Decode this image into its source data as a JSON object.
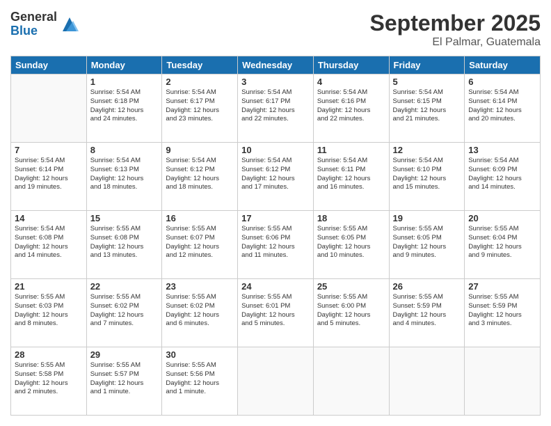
{
  "logo": {
    "general": "General",
    "blue": "Blue"
  },
  "header": {
    "title": "September 2025",
    "location": "El Palmar, Guatemala"
  },
  "weekdays": [
    "Sunday",
    "Monday",
    "Tuesday",
    "Wednesday",
    "Thursday",
    "Friday",
    "Saturday"
  ],
  "weeks": [
    [
      {
        "day": "",
        "info": ""
      },
      {
        "day": "1",
        "info": "Sunrise: 5:54 AM\nSunset: 6:18 PM\nDaylight: 12 hours\nand 24 minutes."
      },
      {
        "day": "2",
        "info": "Sunrise: 5:54 AM\nSunset: 6:17 PM\nDaylight: 12 hours\nand 23 minutes."
      },
      {
        "day": "3",
        "info": "Sunrise: 5:54 AM\nSunset: 6:17 PM\nDaylight: 12 hours\nand 22 minutes."
      },
      {
        "day": "4",
        "info": "Sunrise: 5:54 AM\nSunset: 6:16 PM\nDaylight: 12 hours\nand 22 minutes."
      },
      {
        "day": "5",
        "info": "Sunrise: 5:54 AM\nSunset: 6:15 PM\nDaylight: 12 hours\nand 21 minutes."
      },
      {
        "day": "6",
        "info": "Sunrise: 5:54 AM\nSunset: 6:14 PM\nDaylight: 12 hours\nand 20 minutes."
      }
    ],
    [
      {
        "day": "7",
        "info": "Sunrise: 5:54 AM\nSunset: 6:14 PM\nDaylight: 12 hours\nand 19 minutes."
      },
      {
        "day": "8",
        "info": "Sunrise: 5:54 AM\nSunset: 6:13 PM\nDaylight: 12 hours\nand 18 minutes."
      },
      {
        "day": "9",
        "info": "Sunrise: 5:54 AM\nSunset: 6:12 PM\nDaylight: 12 hours\nand 18 minutes."
      },
      {
        "day": "10",
        "info": "Sunrise: 5:54 AM\nSunset: 6:12 PM\nDaylight: 12 hours\nand 17 minutes."
      },
      {
        "day": "11",
        "info": "Sunrise: 5:54 AM\nSunset: 6:11 PM\nDaylight: 12 hours\nand 16 minutes."
      },
      {
        "day": "12",
        "info": "Sunrise: 5:54 AM\nSunset: 6:10 PM\nDaylight: 12 hours\nand 15 minutes."
      },
      {
        "day": "13",
        "info": "Sunrise: 5:54 AM\nSunset: 6:09 PM\nDaylight: 12 hours\nand 14 minutes."
      }
    ],
    [
      {
        "day": "14",
        "info": "Sunrise: 5:54 AM\nSunset: 6:08 PM\nDaylight: 12 hours\nand 14 minutes."
      },
      {
        "day": "15",
        "info": "Sunrise: 5:55 AM\nSunset: 6:08 PM\nDaylight: 12 hours\nand 13 minutes."
      },
      {
        "day": "16",
        "info": "Sunrise: 5:55 AM\nSunset: 6:07 PM\nDaylight: 12 hours\nand 12 minutes."
      },
      {
        "day": "17",
        "info": "Sunrise: 5:55 AM\nSunset: 6:06 PM\nDaylight: 12 hours\nand 11 minutes."
      },
      {
        "day": "18",
        "info": "Sunrise: 5:55 AM\nSunset: 6:05 PM\nDaylight: 12 hours\nand 10 minutes."
      },
      {
        "day": "19",
        "info": "Sunrise: 5:55 AM\nSunset: 6:05 PM\nDaylight: 12 hours\nand 9 minutes."
      },
      {
        "day": "20",
        "info": "Sunrise: 5:55 AM\nSunset: 6:04 PM\nDaylight: 12 hours\nand 9 minutes."
      }
    ],
    [
      {
        "day": "21",
        "info": "Sunrise: 5:55 AM\nSunset: 6:03 PM\nDaylight: 12 hours\nand 8 minutes."
      },
      {
        "day": "22",
        "info": "Sunrise: 5:55 AM\nSunset: 6:02 PM\nDaylight: 12 hours\nand 7 minutes."
      },
      {
        "day": "23",
        "info": "Sunrise: 5:55 AM\nSunset: 6:02 PM\nDaylight: 12 hours\nand 6 minutes."
      },
      {
        "day": "24",
        "info": "Sunrise: 5:55 AM\nSunset: 6:01 PM\nDaylight: 12 hours\nand 5 minutes."
      },
      {
        "day": "25",
        "info": "Sunrise: 5:55 AM\nSunset: 6:00 PM\nDaylight: 12 hours\nand 5 minutes."
      },
      {
        "day": "26",
        "info": "Sunrise: 5:55 AM\nSunset: 5:59 PM\nDaylight: 12 hours\nand 4 minutes."
      },
      {
        "day": "27",
        "info": "Sunrise: 5:55 AM\nSunset: 5:59 PM\nDaylight: 12 hours\nand 3 minutes."
      }
    ],
    [
      {
        "day": "28",
        "info": "Sunrise: 5:55 AM\nSunset: 5:58 PM\nDaylight: 12 hours\nand 2 minutes."
      },
      {
        "day": "29",
        "info": "Sunrise: 5:55 AM\nSunset: 5:57 PM\nDaylight: 12 hours\nand 1 minute."
      },
      {
        "day": "30",
        "info": "Sunrise: 5:55 AM\nSunset: 5:56 PM\nDaylight: 12 hours\nand 1 minute."
      },
      {
        "day": "",
        "info": ""
      },
      {
        "day": "",
        "info": ""
      },
      {
        "day": "",
        "info": ""
      },
      {
        "day": "",
        "info": ""
      }
    ]
  ]
}
